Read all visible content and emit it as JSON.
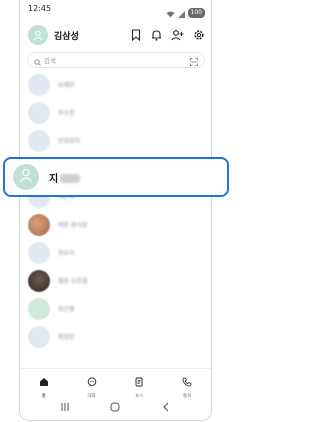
{
  "status_bar": {
    "time": "12:45",
    "battery": "100"
  },
  "header": {
    "name": "김삼성"
  },
  "search": {
    "placeholder": "검색"
  },
  "contacts": [
    {
      "name": "유쾌한",
      "avatar": "plain"
    },
    {
      "name": "주소현",
      "avatar": "plain"
    },
    {
      "name": "은정화학",
      "avatar": "plain"
    },
    {
      "name": "지혜",
      "avatar": "plain"
    },
    {
      "name": "지은숙",
      "avatar": "plain"
    },
    {
      "name": "해운 용사장",
      "avatar": "photo1"
    },
    {
      "name": "정유지",
      "avatar": "plain"
    },
    {
      "name": "헬로 유한결",
      "avatar": "photo2"
    },
    {
      "name": "최은별",
      "avatar": "green"
    },
    {
      "name": "최정민",
      "avatar": "plain"
    }
  ],
  "highlight": {
    "name_visible": "지"
  },
  "tabbar": {
    "tabs": [
      {
        "label": "홈",
        "icon": "home-icon"
      },
      {
        "label": "대화",
        "icon": "chat-icon"
      },
      {
        "label": "뉴스",
        "icon": "news-icon"
      },
      {
        "label": "통화",
        "icon": "phone-icon"
      }
    ]
  },
  "colors": {
    "accent": "#1f73d9",
    "avatar_green": "#bfe2d4"
  }
}
